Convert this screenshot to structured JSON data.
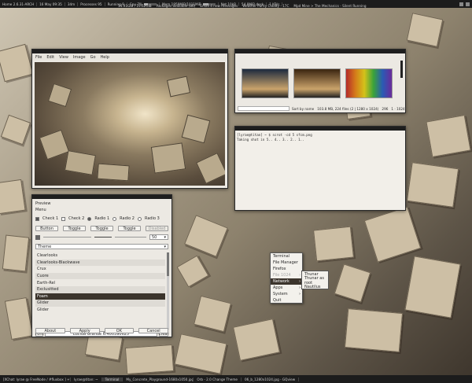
{
  "topbar": {
    "host_label": "Home",
    "host": "2.6.31-ARCH",
    "date": "16 May 09:35",
    "uptime": "34m",
    "proc_label": "Processes",
    "proc": "95",
    "running_label": "Running",
    "running": "9",
    "cpu_label": "Cpu",
    "cpu": "7%",
    "cpu_level": 0.3,
    "mem_label": "Mem",
    "mem": "1959MiB/1011MiB",
    "mem_level": 0.45,
    "net_label": "Net",
    "net": "10kB",
    "disk": "54.8MiB desk",
    "kb": "1 KB/s",
    "line2_proc": "14.91GiB / 19.62GiB",
    "pkgs": "Packages available (86)",
    "mail_label": "Email",
    "mail": "4 new messages",
    "weather_label": "Weather",
    "weather": "Partly Cloudy - 17C",
    "mpd_label": "Mpd",
    "mpd": "Mine > The Mechanics - Silent Running"
  },
  "viewer": {
    "menu": [
      "File",
      "Edit",
      "View",
      "Image",
      "Go",
      "Help"
    ]
  },
  "thumbs": {
    "sort": "Sort by name",
    "info": "103.8 MB, 224 files (2 | 1280 x 1024)",
    "count": "296",
    "pos": "1 · 1024",
    "thumb_colors": [
      "#1c2a3e",
      "#3a2410",
      "#6a2b6a"
    ]
  },
  "terminal": {
    "line1": "[lyrae@titan] ~ $ scrot -cd 5 sfcm.png",
    "line2": "Taking shot in 5.. 4.. 3.. 2.. 1.."
  },
  "preview": {
    "title": "Preview",
    "menu": "Menu",
    "check1": "Check 1",
    "check2": "Check 2",
    "radio1": "Radio 1",
    "radio2": "Radio 2",
    "radio3": "Radio 3",
    "button": "Button",
    "toggle1": "Toggle",
    "toggle2": "Toggle",
    "toggle3": "Toggle",
    "disabled": "Disabled",
    "spin": "50",
    "combo": "Theme",
    "themes": [
      "Clearlooks",
      "Clearlooks-Blackwave",
      "Crux",
      "Cuore",
      "Earth-Rel",
      "Exclusitted",
      "Foam",
      "Glider",
      "Glider"
    ],
    "selected_theme": "Foam",
    "font_label": "Font",
    "font": "Lucida Grande 6.400390625",
    "clear": "Clear",
    "about": "About",
    "apply": "Apply",
    "ok": "OK",
    "cancel": "Cancel"
  },
  "menu": {
    "items": [
      "Terminal",
      "File Manager",
      "Firefox",
      "File 1024",
      "Network",
      "Apps",
      "System",
      "Quit"
    ],
    "highlight": "Network",
    "submenu": [
      "Thunar",
      "Thunar as root",
      "Nautilus"
    ]
  },
  "taskbar": {
    "tasks": [
      "[XChat: lyrae @ FreeNode / #fluxbox ] +t...",
      "lyrae@titan: ~",
      "Terminal",
      "My_Concrete_Playground-1680x1050.jpg",
      "Orb - 2.0 Change Theme",
      "06_b_1280x1024.jpg - GQview"
    ],
    "active_index": 2
  }
}
